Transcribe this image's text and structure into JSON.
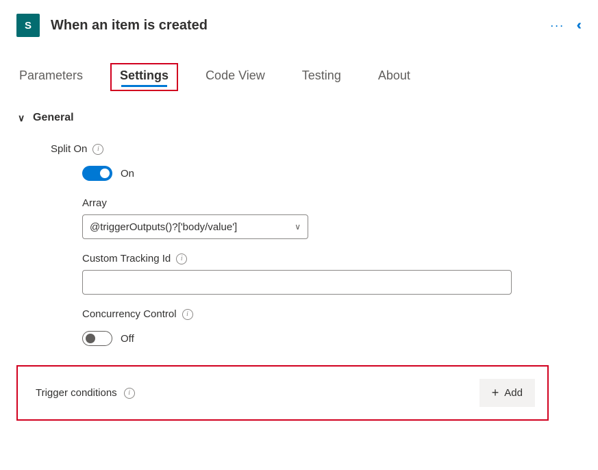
{
  "header": {
    "icon_letter": "S",
    "title": "When an item is created"
  },
  "tabs": {
    "parameters": "Parameters",
    "settings": "Settings",
    "code_view": "Code View",
    "testing": "Testing",
    "about": "About"
  },
  "section": {
    "general_title": "General",
    "split_on_label": "Split On",
    "split_on_state": "On",
    "array_label": "Array",
    "array_value": "@triggerOutputs()?['body/value']",
    "custom_tracking_label": "Custom Tracking Id",
    "custom_tracking_value": "",
    "concurrency_label": "Concurrency Control",
    "concurrency_state": "Off",
    "trigger_conditions_label": "Trigger conditions",
    "add_button": "Add"
  }
}
